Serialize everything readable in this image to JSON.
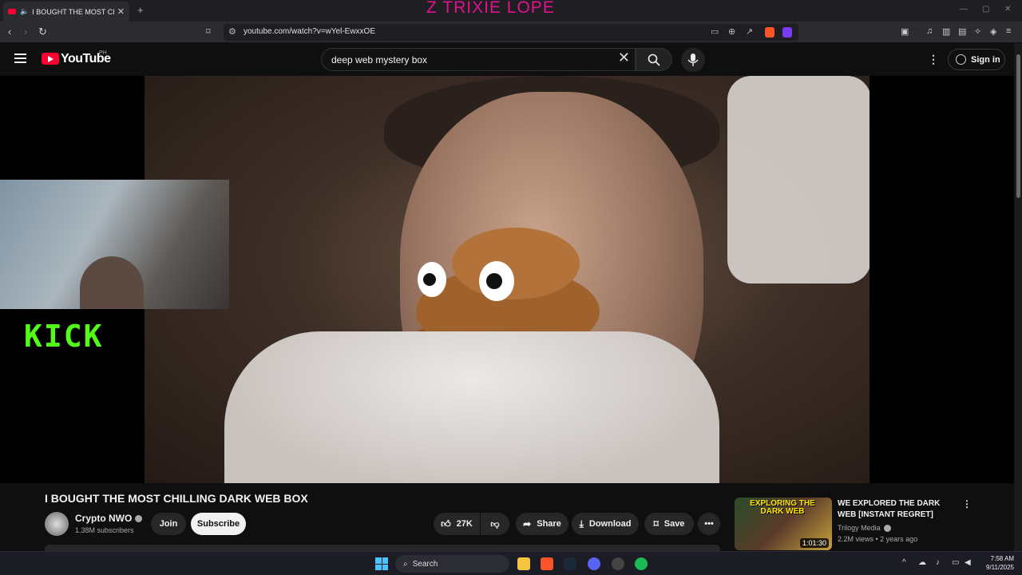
{
  "browser": {
    "tab_title": "I BOUGHT THE MOST CHILLIN",
    "overlay_text": "Z  TRIXIE LOPE",
    "url": "youtube.com/watch?v=wYel-EwxxOE"
  },
  "masthead": {
    "logo_text": "YouTube",
    "country": "PH",
    "search_query": "deep web mystery box",
    "sign_in": "Sign in"
  },
  "stream_overlay": {
    "kick_logo": "KICK"
  },
  "video": {
    "title": "I BOUGHT THE MOST CHILLING DARK WEB BOX",
    "channel": "Crypto NWO",
    "subscribers": "1.38M subscribers",
    "join": "Join",
    "subscribe": "Subscribe",
    "likes": "27K",
    "share": "Share",
    "download": "Download",
    "save": "Save"
  },
  "recommendation": {
    "thumb_text": "EXPLORING THE DARK WEB",
    "duration": "1:01:30",
    "title": "WE EXPLORED THE DARK WEB [INSTANT REGRET]",
    "channel": "Trilogy Media",
    "meta": "2.2M views • 2 years ago"
  },
  "taskbar": {
    "search": "Search",
    "time": "7:58 AM",
    "date": "9/11/2025"
  },
  "colors": {
    "youtube_red": "#ff0033",
    "kick_green": "#53fc18",
    "overlay_pink": "#e0128c"
  }
}
